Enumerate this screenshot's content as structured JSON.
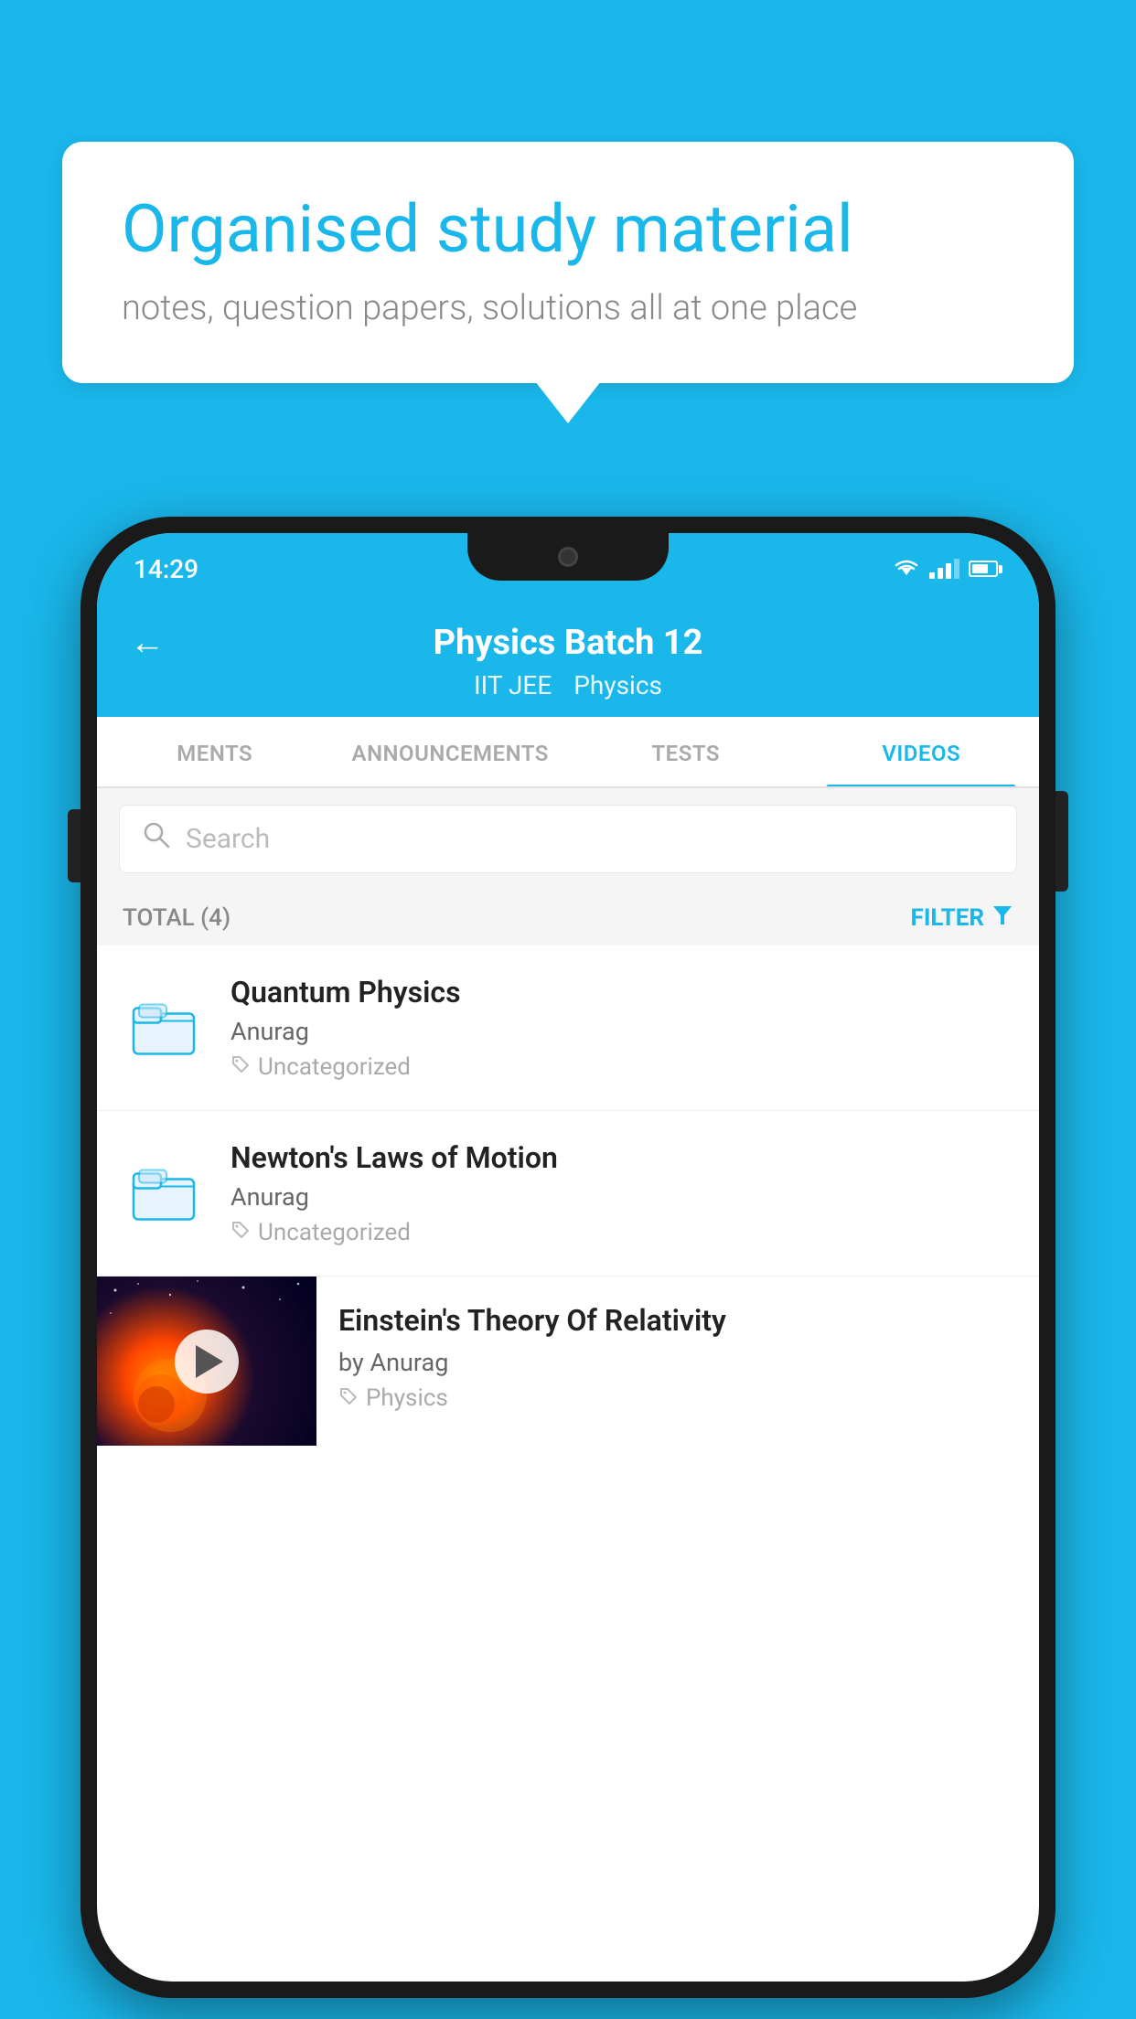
{
  "background_color": "#1ab7ea",
  "speech_bubble": {
    "title": "Organised study material",
    "subtitle": "notes, question papers, solutions all at one place"
  },
  "status_bar": {
    "time": "14:29",
    "wifi": "▾",
    "signal": "signal",
    "battery": "battery"
  },
  "app_header": {
    "back_label": "←",
    "title": "Physics Batch 12",
    "tag1": "IIT JEE",
    "tag2": "Physics"
  },
  "tabs": [
    {
      "label": "MENTS",
      "active": false
    },
    {
      "label": "ANNOUNCEMENTS",
      "active": false
    },
    {
      "label": "TESTS",
      "active": false
    },
    {
      "label": "VIDEOS",
      "active": true
    }
  ],
  "search": {
    "placeholder": "Search"
  },
  "filter_bar": {
    "total_label": "TOTAL (4)",
    "filter_label": "FILTER"
  },
  "videos": [
    {
      "id": 1,
      "title": "Quantum Physics",
      "author": "Anurag",
      "tag": "Uncategorized",
      "has_thumbnail": false
    },
    {
      "id": 2,
      "title": "Newton's Laws of Motion",
      "author": "Anurag",
      "tag": "Uncategorized",
      "has_thumbnail": false
    },
    {
      "id": 3,
      "title": "Einstein's Theory Of Relativity",
      "author": "by Anurag",
      "tag": "Physics",
      "has_thumbnail": true
    }
  ]
}
